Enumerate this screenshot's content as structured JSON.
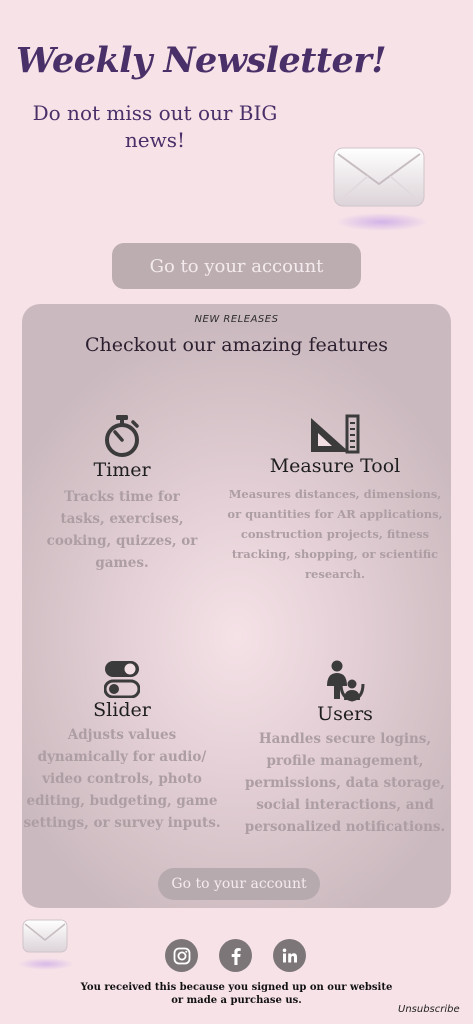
{
  "header": {
    "title": "Weekly Newsletter!",
    "subtitle": "Do not miss out our BIG news!"
  },
  "cta_top": {
    "label": "Go to your account"
  },
  "features_section": {
    "eyebrow": "NEW RELEASES",
    "heading": "Checkout our amazing features",
    "items": [
      {
        "title": "Timer",
        "description": "Tracks time for tasks, exercises, cooking, quizzes, or games.",
        "icon": "stopwatch-icon"
      },
      {
        "title": "Measure Tool",
        "description": "Measures distances, dimensions, or quantities for AR applications, construction projects, fitness tracking, shopping, or scientific research.",
        "icon": "ruler-triangle-icon"
      },
      {
        "title": "Slider",
        "description": "Adjusts values dynamically for audio/ video controls, photo editing, budgeting, game settings, or survey inputs.",
        "icon": "toggle-icon"
      },
      {
        "title": "Users",
        "description": "Handles secure logins, profile management, permissions, data storage, social interactions, and personalized notifications.",
        "icon": "users-icon"
      }
    ],
    "cta_label": "Go to your account"
  },
  "footer": {
    "social": [
      "instagram-icon",
      "facebook-icon",
      "linkedin-icon"
    ],
    "note": "You received this because you signed up on our website or made a purchase us.",
    "unsubscribe": "Unsubscribe"
  },
  "colors": {
    "background": "#f7e2e8",
    "title": "#4a3068",
    "button": "#bcadb0",
    "muted_text": "#ad9ea3"
  }
}
